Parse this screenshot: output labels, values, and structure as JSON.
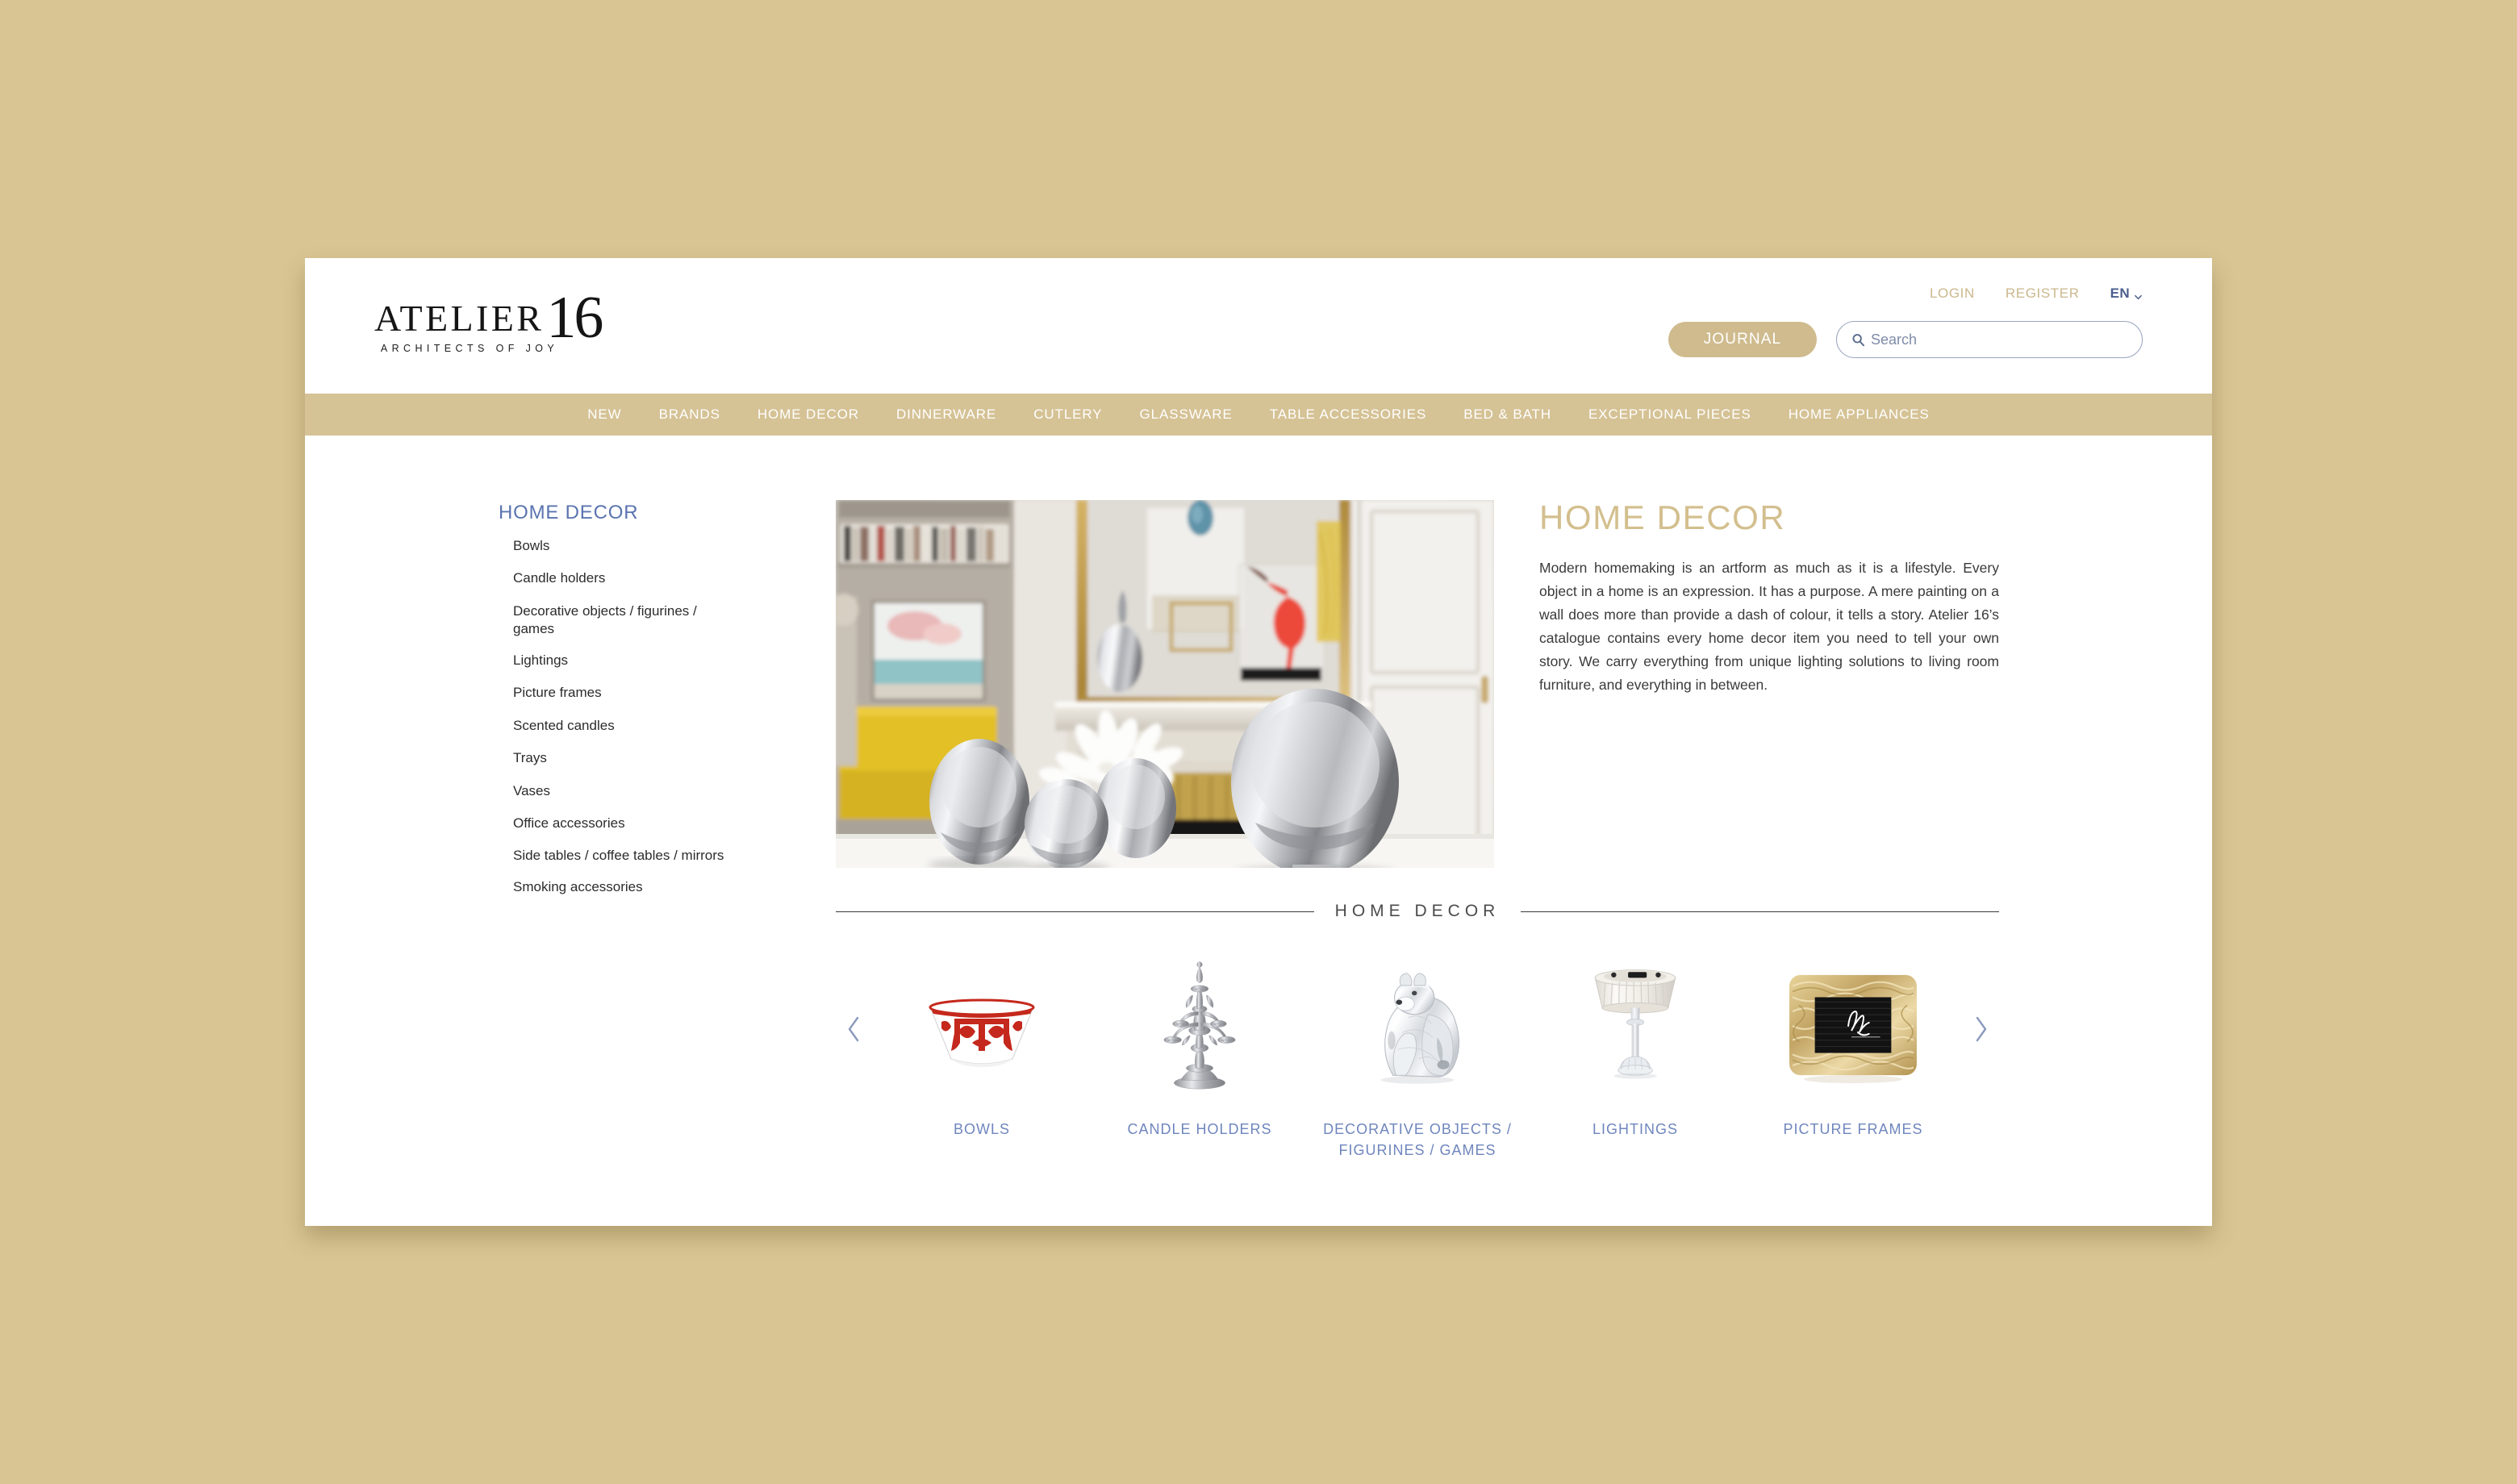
{
  "brand": {
    "name": "ATELIER",
    "number": "16",
    "tagline": "ARCHITECTS OF JOY"
  },
  "header": {
    "login_label": "LOGIN",
    "register_label": "REGISTER",
    "language": "EN",
    "journal_label": "JOURNAL",
    "search_placeholder": "Search",
    "search_value": "",
    "search_icon": "search-icon",
    "chevron_icon": "chevron-down-icon"
  },
  "nav": {
    "items": [
      {
        "label": "NEW"
      },
      {
        "label": "BRANDS"
      },
      {
        "label": "HOME DECOR"
      },
      {
        "label": "DINNERWARE"
      },
      {
        "label": "CUTLERY"
      },
      {
        "label": "GLASSWARE"
      },
      {
        "label": "TABLE ACCESSORIES"
      },
      {
        "label": "BED & BATH"
      },
      {
        "label": "EXCEPTIONAL PIECES"
      },
      {
        "label": "HOME APPLIANCES"
      }
    ]
  },
  "sidebar": {
    "title": "HOME DECOR",
    "items": [
      {
        "label": "Bowls"
      },
      {
        "label": "Candle holders"
      },
      {
        "label": "Decorative objects / figurines / games"
      },
      {
        "label": "Lightings"
      },
      {
        "label": "Picture frames"
      },
      {
        "label": "Scented candles"
      },
      {
        "label": "Trays"
      },
      {
        "label": "Vases"
      },
      {
        "label": "Office accessories"
      },
      {
        "label": "Side tables / coffee tables / mirrors"
      },
      {
        "label": "Smoking accessories"
      }
    ]
  },
  "hero": {
    "alt": "Silver mirrored vases with white lilies on a console in front of a marble fireplace"
  },
  "intro": {
    "title": "HOME DECOR",
    "body": "Modern homemaking is an artform as much as it is a lifestyle. Every object in a home is an expression. It has a purpose. A mere painting on a wall does more than provide a dash of colour, it tells a story. Atelier 16’s catalogue contains every home decor item you need to tell your own story. We carry everything from unique lighting solutions to living room furniture, and everything in between."
  },
  "section": {
    "divider_label": "HOME DECOR"
  },
  "carousel": {
    "prev_icon": "chevron-left-icon",
    "next_icon": "chevron-right-icon",
    "items": [
      {
        "label": "BOWLS",
        "image": "red-ornament-bowl"
      },
      {
        "label": "CANDLE HOLDERS",
        "image": "silver-candelabra"
      },
      {
        "label": "DECORATIVE OBJECTS / FIGURINES / GAMES",
        "image": "crystal-animal-figurine"
      },
      {
        "label": "LIGHTINGS",
        "image": "table-lamp"
      },
      {
        "label": "PICTURE FRAMES",
        "image": "gold-woven-frame"
      }
    ]
  },
  "colors": {
    "canvas": "#d9c593",
    "nav_bar": "#d5c295",
    "accent_tan": "#cfbb8d",
    "link_blue": "#5a74b0",
    "title_gold": "#d3bf8e",
    "card_label": "#6f86bd"
  }
}
